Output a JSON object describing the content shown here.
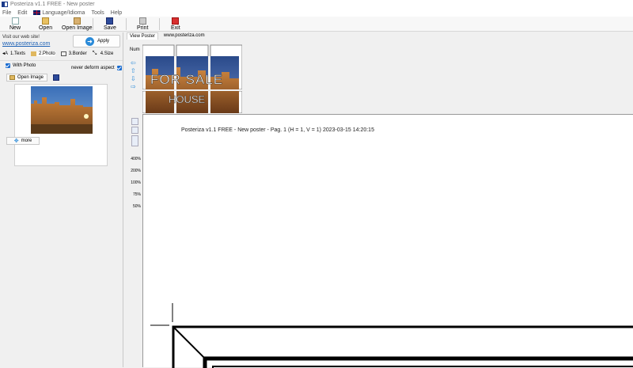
{
  "window": {
    "title": "Posteriza v1.1 FREE - New poster"
  },
  "menu": [
    "File",
    "Edit",
    "Language/Idioma",
    "Tools",
    "Help"
  ],
  "toolbar": {
    "new": "New",
    "open": "Open",
    "open_image": "Open Image",
    "save": "Save",
    "print": "Print",
    "exit": "Exit"
  },
  "left": {
    "visit": "Visit our web site!",
    "link": "www.posteriza.com",
    "apply": "Apply",
    "tabs": [
      "1.Texts",
      "2.Photo",
      "3.Border",
      "4.Size"
    ],
    "with_photo": "With Photo",
    "never_deform": "never deform aspect",
    "open_image": "Open Image",
    "more": "more"
  },
  "view": {
    "tabs": [
      "View Poster",
      "www.posteriza.com"
    ],
    "num": "Num",
    "poster_text1": "FOR SALE",
    "poster_text2": "HOUSE",
    "zoom_levels": [
      "400%",
      "200%",
      "100%",
      "75%",
      "50%"
    ],
    "page_header": "Posteriza v1.1 FREE - New poster - Pag. 1 (H = 1, V = 1) 2023-03-15  14:20:15"
  },
  "colors": {
    "accent": "#2a8ad8",
    "link": "#1a5fb4"
  }
}
